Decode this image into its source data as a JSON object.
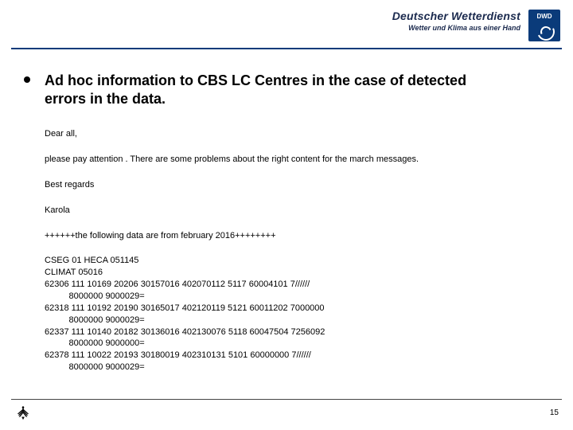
{
  "header": {
    "brand_title": "Deutscher Wetterdienst",
    "brand_sub": "Wetter und Klima aus einer Hand",
    "logo_label": "DWD"
  },
  "content": {
    "title": "Ad hoc information to CBS LC Centres in the case of detected errors in the data.",
    "paragraphs": [
      "Dear all,",
      "please pay attention . There are some problems about the right content for the march messages.",
      "Best regards",
      "Karola",
      "++++++the following data are from february 2016++++++++"
    ],
    "data_block": "CSEG 01 HECA 051145\nCLIMAT 05016\n62306 111 10169 20206 30157016 402070112 5117 60004101 7//////\n          8000000 9000029=\n62318 111 10192 20190 30165017 402120119 5121 60011202 7000000\n          8000000 9000029=\n62337 111 10140 20182 30136016 402130076 5118 60047504 7256092\n          8000000 9000000=\n62378 111 10022 20193 30180019 402310131 5101 60000000 7//////\n          8000000 9000029="
  },
  "footer": {
    "page_number": "15"
  }
}
